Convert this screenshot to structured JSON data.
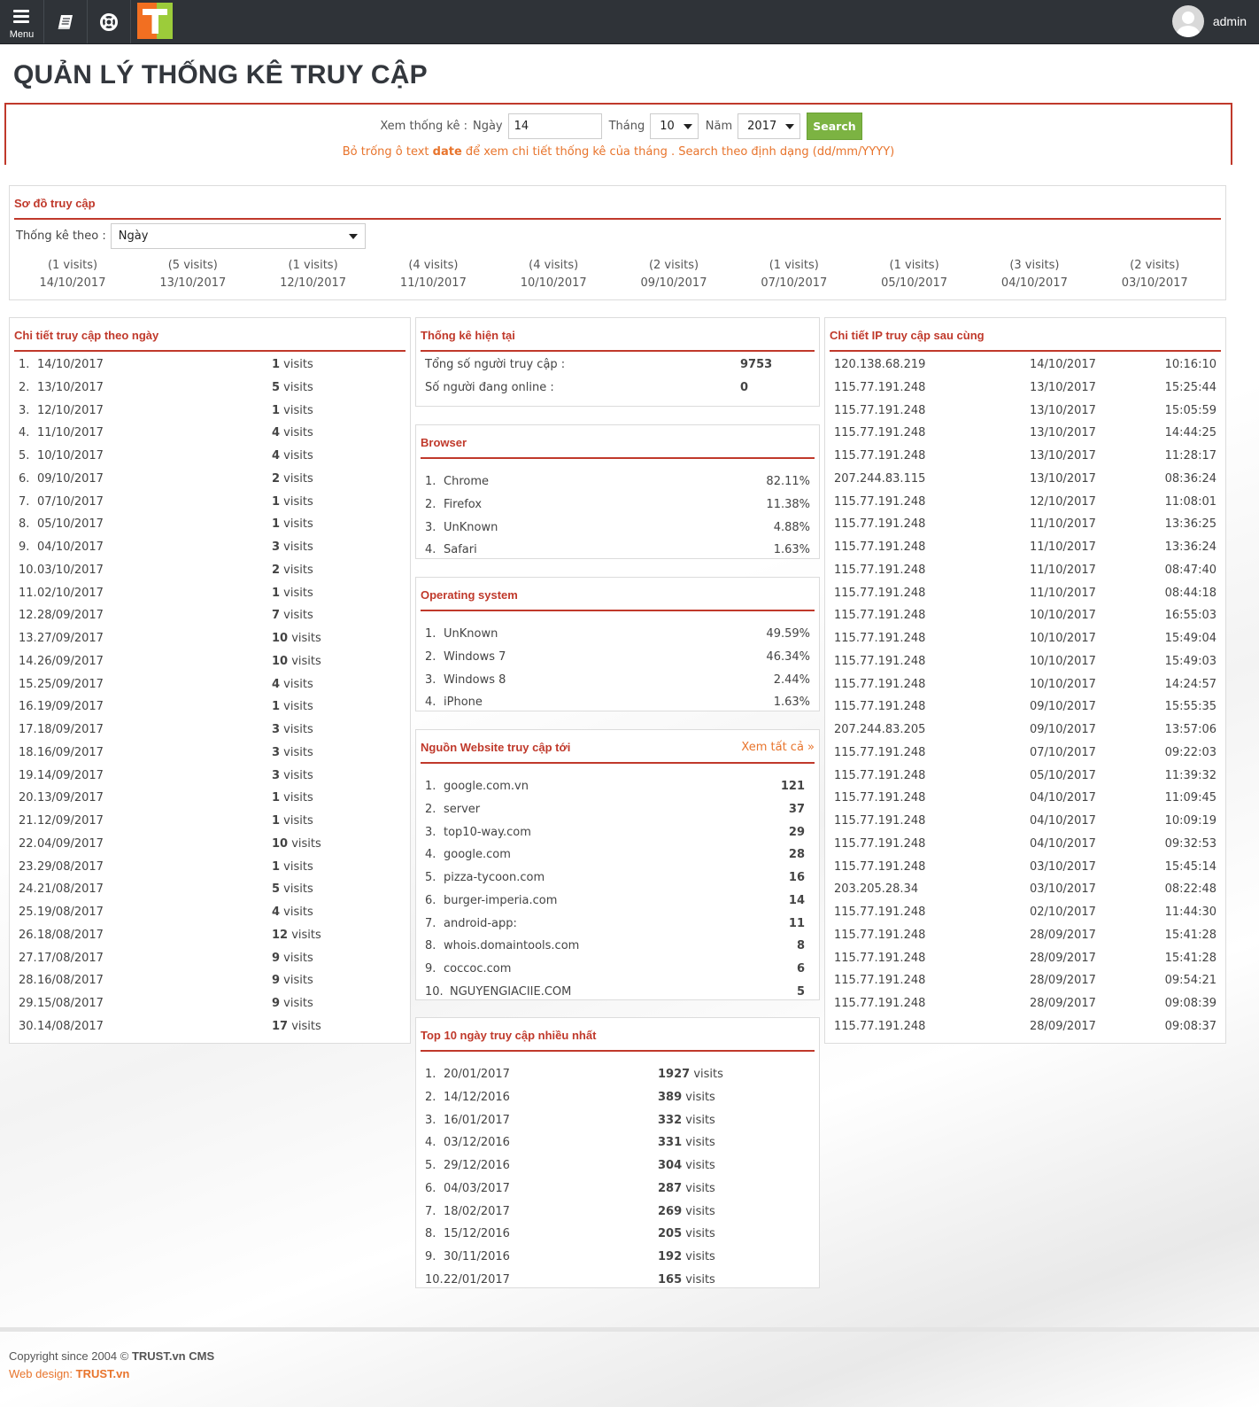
{
  "topbar": {
    "menu_label": "Menu",
    "logo_letter": "T",
    "user_name": "admin"
  },
  "page_title": "QUẢN LÝ THỐNG KÊ TRUY CẬP",
  "filter": {
    "view_label": "Xem thống kê :",
    "day_label": "Ngày",
    "day_value": "14",
    "month_label": "Tháng",
    "month_value": "10",
    "year_label": "Năm",
    "year_value": "2017",
    "search_label": "Search",
    "note_pre": "Bỏ trống ô text ",
    "note_bold": "date",
    "note_post": " để xem chi tiết thống kê của tháng . Search theo định dạng (dd/mm/YYYY)"
  },
  "chart_box": {
    "title": "Sơ đồ truy cập",
    "stat_by_label": "Thống kê theo :",
    "stat_by_value": "Ngày"
  },
  "chart_data": {
    "type": "bar",
    "categories": [
      "14/10/2017",
      "13/10/2017",
      "12/10/2017",
      "11/10/2017",
      "10/10/2017",
      "09/10/2017",
      "07/10/2017",
      "05/10/2017",
      "04/10/2017",
      "03/10/2017"
    ],
    "value_labels": [
      "(1 visits)",
      "(5 visits)",
      "(1 visits)",
      "(4 visits)",
      "(4 visits)",
      "(2 visits)",
      "(1 visits)",
      "(1 visits)",
      "(3 visits)",
      "(2 visits)"
    ],
    "values": [
      1,
      5,
      1,
      4,
      4,
      2,
      1,
      1,
      3,
      2
    ]
  },
  "daily": {
    "title": "Chi tiết truy cập theo ngày",
    "unit": " visits",
    "rows": [
      {
        "n": "1.",
        "date": "14/10/2017",
        "visits": "1"
      },
      {
        "n": "2.",
        "date": "13/10/2017",
        "visits": "5"
      },
      {
        "n": "3.",
        "date": "12/10/2017",
        "visits": "1"
      },
      {
        "n": "4.",
        "date": "11/10/2017",
        "visits": "4"
      },
      {
        "n": "5.",
        "date": "10/10/2017",
        "visits": "4"
      },
      {
        "n": "6.",
        "date": "09/10/2017",
        "visits": "2"
      },
      {
        "n": "7.",
        "date": "07/10/2017",
        "visits": "1"
      },
      {
        "n": "8.",
        "date": "05/10/2017",
        "visits": "1"
      },
      {
        "n": "9.",
        "date": "04/10/2017",
        "visits": "3"
      },
      {
        "n": "10.",
        "date": "03/10/2017",
        "visits": "2"
      },
      {
        "n": "11.",
        "date": "02/10/2017",
        "visits": "1"
      },
      {
        "n": "12.",
        "date": "28/09/2017",
        "visits": "7"
      },
      {
        "n": "13.",
        "date": "27/09/2017",
        "visits": "10"
      },
      {
        "n": "14.",
        "date": "26/09/2017",
        "visits": "10"
      },
      {
        "n": "15.",
        "date": "25/09/2017",
        "visits": "4"
      },
      {
        "n": "16.",
        "date": "19/09/2017",
        "visits": "1"
      },
      {
        "n": "17.",
        "date": "18/09/2017",
        "visits": "3"
      },
      {
        "n": "18.",
        "date": "16/09/2017",
        "visits": "3"
      },
      {
        "n": "19.",
        "date": "14/09/2017",
        "visits": "3"
      },
      {
        "n": "20.",
        "date": "13/09/2017",
        "visits": "1"
      },
      {
        "n": "21.",
        "date": "12/09/2017",
        "visits": "1"
      },
      {
        "n": "22.",
        "date": "04/09/2017",
        "visits": "10"
      },
      {
        "n": "23.",
        "date": "29/08/2017",
        "visits": "1"
      },
      {
        "n": "24.",
        "date": "21/08/2017",
        "visits": "5"
      },
      {
        "n": "25.",
        "date": "19/08/2017",
        "visits": "4"
      },
      {
        "n": "26.",
        "date": "18/08/2017",
        "visits": "12"
      },
      {
        "n": "27.",
        "date": "17/08/2017",
        "visits": "9"
      },
      {
        "n": "28.",
        "date": "16/08/2017",
        "visits": "9"
      },
      {
        "n": "29.",
        "date": "15/08/2017",
        "visits": "9"
      },
      {
        "n": "30.",
        "date": "14/08/2017",
        "visits": "17"
      }
    ]
  },
  "current": {
    "title": "Thống kê hiện tại",
    "rows": [
      {
        "label": "Tổng số người truy cập :",
        "value": "9753"
      },
      {
        "label": "Số người đang online :",
        "value": "0"
      }
    ]
  },
  "browser": {
    "title": "Browser",
    "rows": [
      {
        "n": "1.",
        "name": "Chrome",
        "pct": "82.11%"
      },
      {
        "n": "2.",
        "name": "Firefox",
        "pct": "11.38%"
      },
      {
        "n": "3.",
        "name": "UnKnown",
        "pct": "4.88%"
      },
      {
        "n": "4.",
        "name": "Safari",
        "pct": "1.63%"
      }
    ]
  },
  "os": {
    "title": "Operating system",
    "rows": [
      {
        "n": "1.",
        "name": "UnKnown",
        "pct": "49.59%"
      },
      {
        "n": "2.",
        "name": "Windows 7",
        "pct": "46.34%"
      },
      {
        "n": "3.",
        "name": "Windows 8",
        "pct": "2.44%"
      },
      {
        "n": "4.",
        "name": "iPhone",
        "pct": "1.63%"
      }
    ]
  },
  "sources": {
    "title": "Nguồn Website truy cập tới",
    "more_label": "Xem tất cả »",
    "rows": [
      {
        "n": "1.",
        "name": "google.com.vn",
        "count": "121"
      },
      {
        "n": "2.",
        "name": "server",
        "count": "37"
      },
      {
        "n": "3.",
        "name": "top10-way.com",
        "count": "29"
      },
      {
        "n": "4.",
        "name": "google.com",
        "count": "28"
      },
      {
        "n": "5.",
        "name": "pizza-tycoon.com",
        "count": "16"
      },
      {
        "n": "6.",
        "name": "burger-imperia.com",
        "count": "14"
      },
      {
        "n": "7.",
        "name": "android-app:",
        "count": "11"
      },
      {
        "n": "8.",
        "name": "whois.domaintools.com",
        "count": "8"
      },
      {
        "n": "9.",
        "name": "coccoc.com",
        "count": "6"
      },
      {
        "n": "10.",
        "name": "NGUYENGIACIIE.COM",
        "count": "5"
      }
    ]
  },
  "top10": {
    "title": "Top 10 ngày truy cập nhiều nhất",
    "unit": " visits",
    "rows": [
      {
        "n": "1.",
        "date": "20/01/2017",
        "visits": "1927"
      },
      {
        "n": "2.",
        "date": "14/12/2016",
        "visits": "389"
      },
      {
        "n": "3.",
        "date": "16/01/2017",
        "visits": "332"
      },
      {
        "n": "4.",
        "date": "03/12/2016",
        "visits": "331"
      },
      {
        "n": "5.",
        "date": "29/12/2016",
        "visits": "304"
      },
      {
        "n": "6.",
        "date": "04/03/2017",
        "visits": "287"
      },
      {
        "n": "7.",
        "date": "18/02/2017",
        "visits": "269"
      },
      {
        "n": "8.",
        "date": "15/12/2016",
        "visits": "205"
      },
      {
        "n": "9.",
        "date": "30/11/2016",
        "visits": "192"
      },
      {
        "n": "10.",
        "date": "22/01/2017",
        "visits": "165"
      }
    ]
  },
  "ips": {
    "title": "Chi tiết IP truy cập sau cùng",
    "rows": [
      {
        "ip": "120.138.68.219",
        "date": "14/10/2017",
        "time": "10:16:10"
      },
      {
        "ip": "115.77.191.248",
        "date": "13/10/2017",
        "time": "15:25:44"
      },
      {
        "ip": "115.77.191.248",
        "date": "13/10/2017",
        "time": "15:05:59"
      },
      {
        "ip": "115.77.191.248",
        "date": "13/10/2017",
        "time": "14:44:25"
      },
      {
        "ip": "115.77.191.248",
        "date": "13/10/2017",
        "time": "11:28:17"
      },
      {
        "ip": "207.244.83.115",
        "date": "13/10/2017",
        "time": "08:36:24"
      },
      {
        "ip": "115.77.191.248",
        "date": "12/10/2017",
        "time": "11:08:01"
      },
      {
        "ip": "115.77.191.248",
        "date": "11/10/2017",
        "time": "13:36:25"
      },
      {
        "ip": "115.77.191.248",
        "date": "11/10/2017",
        "time": "13:36:24"
      },
      {
        "ip": "115.77.191.248",
        "date": "11/10/2017",
        "time": "08:47:40"
      },
      {
        "ip": "115.77.191.248",
        "date": "11/10/2017",
        "time": "08:44:18"
      },
      {
        "ip": "115.77.191.248",
        "date": "10/10/2017",
        "time": "16:55:03"
      },
      {
        "ip": "115.77.191.248",
        "date": "10/10/2017",
        "time": "15:49:04"
      },
      {
        "ip": "115.77.191.248",
        "date": "10/10/2017",
        "time": "15:49:03"
      },
      {
        "ip": "115.77.191.248",
        "date": "10/10/2017",
        "time": "14:24:57"
      },
      {
        "ip": "115.77.191.248",
        "date": "09/10/2017",
        "time": "15:55:35"
      },
      {
        "ip": "207.244.83.205",
        "date": "09/10/2017",
        "time": "13:57:06"
      },
      {
        "ip": "115.77.191.248",
        "date": "07/10/2017",
        "time": "09:22:03"
      },
      {
        "ip": "115.77.191.248",
        "date": "05/10/2017",
        "time": "11:39:32"
      },
      {
        "ip": "115.77.191.248",
        "date": "04/10/2017",
        "time": "11:09:45"
      },
      {
        "ip": "115.77.191.248",
        "date": "04/10/2017",
        "time": "10:09:19"
      },
      {
        "ip": "115.77.191.248",
        "date": "04/10/2017",
        "time": "09:32:53"
      },
      {
        "ip": "115.77.191.248",
        "date": "03/10/2017",
        "time": "15:45:14"
      },
      {
        "ip": "203.205.28.34",
        "date": "03/10/2017",
        "time": "08:22:48"
      },
      {
        "ip": "115.77.191.248",
        "date": "02/10/2017",
        "time": "11:44:30"
      },
      {
        "ip": "115.77.191.248",
        "date": "28/09/2017",
        "time": "15:41:28"
      },
      {
        "ip": "115.77.191.248",
        "date": "28/09/2017",
        "time": "15:41:28"
      },
      {
        "ip": "115.77.191.248",
        "date": "28/09/2017",
        "time": "09:54:21"
      },
      {
        "ip": "115.77.191.248",
        "date": "28/09/2017",
        "time": "09:08:39"
      },
      {
        "ip": "115.77.191.248",
        "date": "28/09/2017",
        "time": "09:08:37"
      }
    ]
  },
  "footer": {
    "copyright_pre": "Copyright since 2004 © ",
    "copyright_brand": "TRUST.vn CMS",
    "design_pre": "Web design: ",
    "design_brand": "TRUST.vn"
  },
  "colors": {
    "accent_red": "#c0392b",
    "accent_orange": "#e8742c",
    "search_green": "#7cb342",
    "topbar": "#2f3338"
  }
}
